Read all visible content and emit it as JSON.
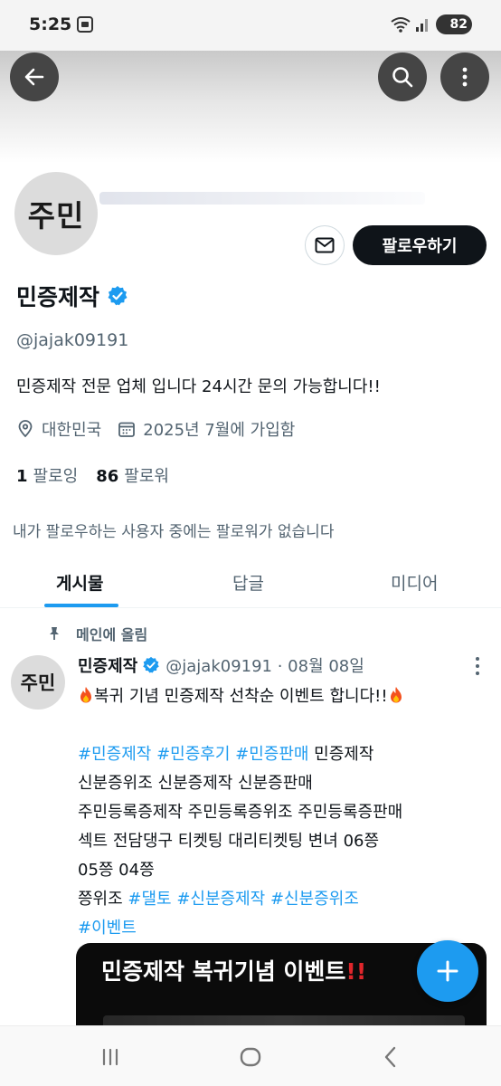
{
  "status_bar": {
    "time": "5:25",
    "battery": "82"
  },
  "header": {
    "back": "back-arrow-icon",
    "search": "search-icon",
    "more": "more-vertical-icon"
  },
  "profile": {
    "avatar_text": "주민",
    "follow_button": "팔로우하기",
    "name": "민증제작",
    "handle": "@jajak09191",
    "bio": "민증제작 전문 업체 입니다 24시간 문의 가능합니다!!",
    "location": "대한민국",
    "joined": "2025년 7월에 가입함",
    "following_count": "1",
    "following_label": "팔로잉",
    "followers_count": "86",
    "followers_label": "팔로워",
    "no_followers_note": "내가 팔로우하는 사용자 중에는 팔로워가 없습니다"
  },
  "tabs": [
    {
      "label": "게시물",
      "active": true
    },
    {
      "label": "답글",
      "active": false
    },
    {
      "label": "미디어",
      "active": false
    }
  ],
  "pinned_post": {
    "pinned_label": "메인에 올림",
    "avatar_text": "주민",
    "author_name": "민증제작",
    "handle_date": "@jajak09191 · 08월 08일",
    "headline": "복귀 기념 민증제작 선착순 이벤트 합니다!!",
    "tag1": "#민증제작",
    "tag2": "#민증후기",
    "tag3": "#민증판매",
    "text1": " 민증제작",
    "line2": "신분증위조 신분증제작 신분증판매",
    "line3": "주민등록증제작 주민등록증위조 주민등록증판매",
    "line4": "섹트 전담댕구 티켓팅 대리티켓팅 변녀 06쯩",
    "line5": "05쯩 04쯩",
    "text6": "쯩위조 ",
    "tag4": "#댈토",
    "tag5": "#신분증제작",
    "tag6": "#신분증위조",
    "tag7": "#이벤트",
    "media_title": "민증제작 복귀기념 이벤트",
    "media_excl": "!!"
  },
  "colors": {
    "accent": "#1d9bf0",
    "text": "#0f1419",
    "muted": "#536471"
  }
}
